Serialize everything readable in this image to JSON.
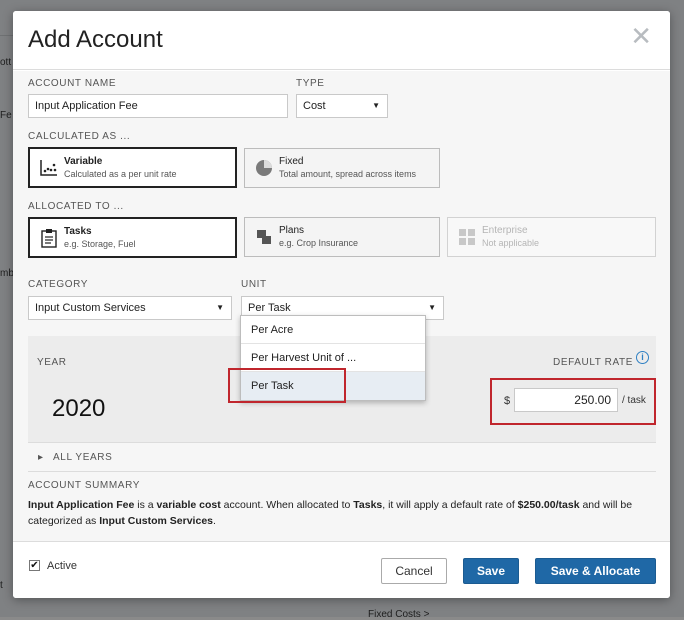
{
  "modal": {
    "title": "Add Account",
    "close_glyph": "✕"
  },
  "account_name": {
    "label": "ACCOUNT NAME",
    "value": "Input Application Fee"
  },
  "type": {
    "label": "TYPE",
    "selected": "Cost"
  },
  "calculated_as": {
    "label": "CALCULATED AS ...",
    "options": [
      {
        "title": "Variable",
        "subtitle": "Calculated as a per unit rate",
        "icon": "scatter-chart-icon",
        "selected": true
      },
      {
        "title": "Fixed",
        "subtitle": "Total amount, spread across items",
        "icon": "pie-chart-icon",
        "selected": false
      }
    ]
  },
  "allocated_to": {
    "label": "ALLOCATED TO ...",
    "options": [
      {
        "title": "Tasks",
        "subtitle": "e.g. Storage, Fuel",
        "icon": "clipboard-icon",
        "selected": true
      },
      {
        "title": "Plans",
        "subtitle": "e.g. Crop Insurance",
        "icon": "plan-icon",
        "selected": false
      },
      {
        "title": "Enterprise",
        "subtitle": "Not applicable",
        "icon": "grid-icon",
        "selected": false,
        "disabled": true
      }
    ]
  },
  "category": {
    "label": "CATEGORY",
    "selected": "Input Custom Services"
  },
  "unit": {
    "label": "UNIT",
    "selected": "Per Task",
    "options": [
      "Per Acre",
      "Per Harvest Unit of ...",
      "Per Task"
    ]
  },
  "year_panel": {
    "year_label": "YEAR",
    "rate_label": "DEFAULT RATE",
    "year": "2020",
    "currency": "$",
    "rate": "250.00",
    "rate_unit": "/ task",
    "info_glyph": "i"
  },
  "all_years": {
    "label": "ALL YEARS",
    "chevron": "▸"
  },
  "summary": {
    "heading": "ACCOUNT SUMMARY",
    "name": "Input Application Fee",
    "t1": " is a ",
    "kind": "variable cost",
    "t2": " account. When allocated to ",
    "target": "Tasks",
    "t3": ", it will apply a default rate of ",
    "rate": "$250.00/task",
    "t4": " and will be categorized as ",
    "category": "Input Custom Services",
    "t5": "."
  },
  "footer": {
    "active_label": "Active",
    "active_checked": "✔",
    "cancel": "Cancel",
    "save": "Save",
    "save_allocate": "Save & Allocate"
  },
  "background": {
    "fragments": [
      "ott",
      "Fe",
      "mbu",
      "t"
    ],
    "fixed_costs": "Fixed Costs >"
  }
}
